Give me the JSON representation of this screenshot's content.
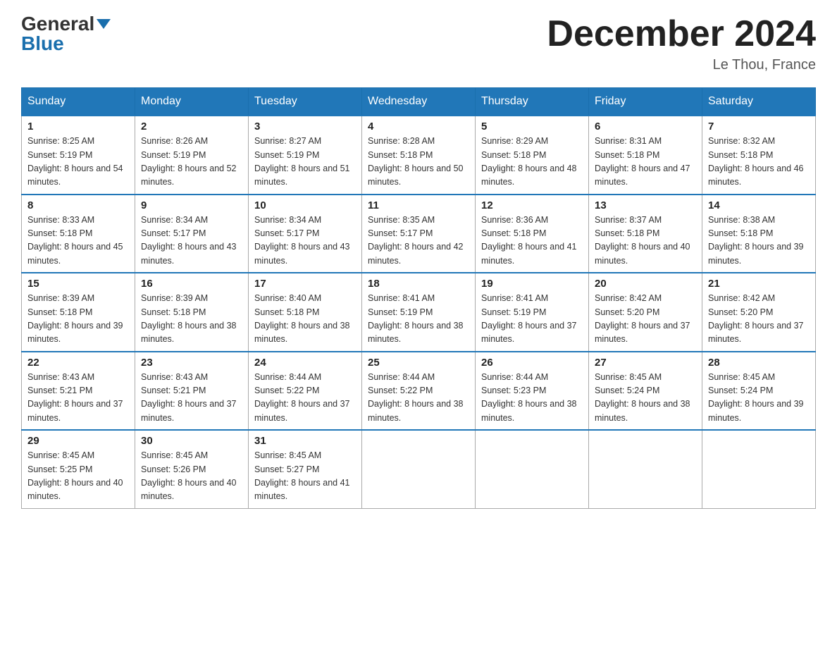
{
  "header": {
    "logo_general": "General",
    "logo_blue": "Blue",
    "month_title": "December 2024",
    "location": "Le Thou, France"
  },
  "days_of_week": [
    "Sunday",
    "Monday",
    "Tuesday",
    "Wednesday",
    "Thursday",
    "Friday",
    "Saturday"
  ],
  "weeks": [
    [
      {
        "day": "1",
        "sunrise": "8:25 AM",
        "sunset": "5:19 PM",
        "daylight": "8 hours and 54 minutes."
      },
      {
        "day": "2",
        "sunrise": "8:26 AM",
        "sunset": "5:19 PM",
        "daylight": "8 hours and 52 minutes."
      },
      {
        "day": "3",
        "sunrise": "8:27 AM",
        "sunset": "5:19 PM",
        "daylight": "8 hours and 51 minutes."
      },
      {
        "day": "4",
        "sunrise": "8:28 AM",
        "sunset": "5:18 PM",
        "daylight": "8 hours and 50 minutes."
      },
      {
        "day": "5",
        "sunrise": "8:29 AM",
        "sunset": "5:18 PM",
        "daylight": "8 hours and 48 minutes."
      },
      {
        "day": "6",
        "sunrise": "8:31 AM",
        "sunset": "5:18 PM",
        "daylight": "8 hours and 47 minutes."
      },
      {
        "day": "7",
        "sunrise": "8:32 AM",
        "sunset": "5:18 PM",
        "daylight": "8 hours and 46 minutes."
      }
    ],
    [
      {
        "day": "8",
        "sunrise": "8:33 AM",
        "sunset": "5:18 PM",
        "daylight": "8 hours and 45 minutes."
      },
      {
        "day": "9",
        "sunrise": "8:34 AM",
        "sunset": "5:17 PM",
        "daylight": "8 hours and 43 minutes."
      },
      {
        "day": "10",
        "sunrise": "8:34 AM",
        "sunset": "5:17 PM",
        "daylight": "8 hours and 43 minutes."
      },
      {
        "day": "11",
        "sunrise": "8:35 AM",
        "sunset": "5:17 PM",
        "daylight": "8 hours and 42 minutes."
      },
      {
        "day": "12",
        "sunrise": "8:36 AM",
        "sunset": "5:18 PM",
        "daylight": "8 hours and 41 minutes."
      },
      {
        "day": "13",
        "sunrise": "8:37 AM",
        "sunset": "5:18 PM",
        "daylight": "8 hours and 40 minutes."
      },
      {
        "day": "14",
        "sunrise": "8:38 AM",
        "sunset": "5:18 PM",
        "daylight": "8 hours and 39 minutes."
      }
    ],
    [
      {
        "day": "15",
        "sunrise": "8:39 AM",
        "sunset": "5:18 PM",
        "daylight": "8 hours and 39 minutes."
      },
      {
        "day": "16",
        "sunrise": "8:39 AM",
        "sunset": "5:18 PM",
        "daylight": "8 hours and 38 minutes."
      },
      {
        "day": "17",
        "sunrise": "8:40 AM",
        "sunset": "5:18 PM",
        "daylight": "8 hours and 38 minutes."
      },
      {
        "day": "18",
        "sunrise": "8:41 AM",
        "sunset": "5:19 PM",
        "daylight": "8 hours and 38 minutes."
      },
      {
        "day": "19",
        "sunrise": "8:41 AM",
        "sunset": "5:19 PM",
        "daylight": "8 hours and 37 minutes."
      },
      {
        "day": "20",
        "sunrise": "8:42 AM",
        "sunset": "5:20 PM",
        "daylight": "8 hours and 37 minutes."
      },
      {
        "day": "21",
        "sunrise": "8:42 AM",
        "sunset": "5:20 PM",
        "daylight": "8 hours and 37 minutes."
      }
    ],
    [
      {
        "day": "22",
        "sunrise": "8:43 AM",
        "sunset": "5:21 PM",
        "daylight": "8 hours and 37 minutes."
      },
      {
        "day": "23",
        "sunrise": "8:43 AM",
        "sunset": "5:21 PM",
        "daylight": "8 hours and 37 minutes."
      },
      {
        "day": "24",
        "sunrise": "8:44 AM",
        "sunset": "5:22 PM",
        "daylight": "8 hours and 37 minutes."
      },
      {
        "day": "25",
        "sunrise": "8:44 AM",
        "sunset": "5:22 PM",
        "daylight": "8 hours and 38 minutes."
      },
      {
        "day": "26",
        "sunrise": "8:44 AM",
        "sunset": "5:23 PM",
        "daylight": "8 hours and 38 minutes."
      },
      {
        "day": "27",
        "sunrise": "8:45 AM",
        "sunset": "5:24 PM",
        "daylight": "8 hours and 38 minutes."
      },
      {
        "day": "28",
        "sunrise": "8:45 AM",
        "sunset": "5:24 PM",
        "daylight": "8 hours and 39 minutes."
      }
    ],
    [
      {
        "day": "29",
        "sunrise": "8:45 AM",
        "sunset": "5:25 PM",
        "daylight": "8 hours and 40 minutes."
      },
      {
        "day": "30",
        "sunrise": "8:45 AM",
        "sunset": "5:26 PM",
        "daylight": "8 hours and 40 minutes."
      },
      {
        "day": "31",
        "sunrise": "8:45 AM",
        "sunset": "5:27 PM",
        "daylight": "8 hours and 41 minutes."
      },
      null,
      null,
      null,
      null
    ]
  ]
}
